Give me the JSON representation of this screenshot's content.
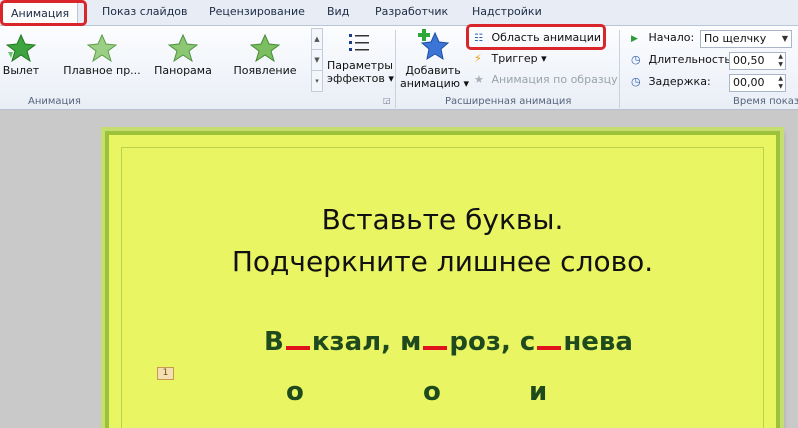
{
  "tabs": [
    {
      "label": "Анимация",
      "active": true
    },
    {
      "label": "Показ слайдов"
    },
    {
      "label": "Рецензирование"
    },
    {
      "label": "Вид"
    },
    {
      "label": "Разработчик"
    },
    {
      "label": "Надстройки"
    }
  ],
  "ribbon": {
    "animation_gallery": [
      "Вылет",
      "Плавное пр...",
      "Панорама",
      "Появление"
    ],
    "effect_params": {
      "line1": "Параметры",
      "line2": "эффектов"
    },
    "group_animation": "Анимация",
    "add_animation": {
      "line1": "Добавить",
      "line2": "анимацию"
    },
    "anim_pane": "Область анимации",
    "trigger": "Триггер",
    "anim_painter": "Анимация по образцу",
    "group_advanced": "Расширенная анимация",
    "start_label": "Начало:",
    "start_value": "По щелчку",
    "duration_label": "Длительность:",
    "duration_value": "00,50",
    "delay_label": "Задержка:",
    "delay_value": "00,00",
    "group_timing": "Время показа"
  },
  "slide": {
    "title_line1": "Вставьте буквы.",
    "title_line2": "Подчеркните лишнее слово.",
    "word1_a": "В",
    "word1_b": "кзал,",
    "word2_a": "м",
    "word2_b": "роз,",
    "word3_a": "с",
    "word3_b": "нева",
    "answer1": "о",
    "answer2": "о",
    "answer3": "и",
    "anim_tag": "1"
  },
  "colors": {
    "accent_highlight": "#d9262b",
    "slide_bg": "#eaf563",
    "slide_border": "#9bc23a",
    "word_text": "#1e4a1e",
    "gap_red": "#e0121b"
  }
}
